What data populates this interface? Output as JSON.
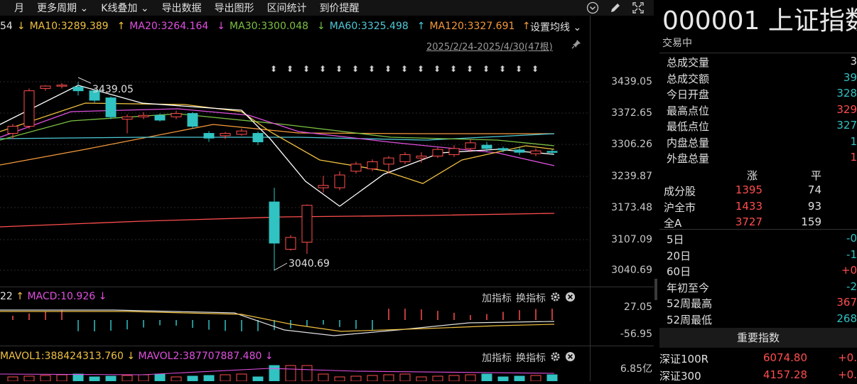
{
  "toolbar": {
    "items": [
      "月",
      "更多周期 ⌄",
      "K线叠加 ⌄",
      "导出数据",
      "导出图形",
      "区间统计",
      "到价提醒"
    ],
    "icons": [
      "chevron-circle-icon",
      "pen-icon",
      "minimize-icon",
      "fullscreen-icon"
    ]
  },
  "ma": {
    "prefix": "54",
    "ma10": "MA10:3289.389",
    "ma10_arrow": "↓",
    "ma20": "MA20:3264.164",
    "ma20_arrow": "↑",
    "ma30": "MA30:3300.048",
    "ma30_arrow": "↓",
    "ma60": "MA60:3325.498",
    "ma60_arrow": "↓",
    "ma120": "MA120:3327.691",
    "ma120_arrow": "↑",
    "settings": "设置均线 ⌄",
    "colors": {
      "ma5": "#ffffff",
      "ma10": "#f0c040",
      "ma20": "#e050e0",
      "ma30": "#7bc043",
      "ma60": "#4ec9d8",
      "ma120": "#f59a3c"
    }
  },
  "range": "2025/2/24-2025/4/30(47根)",
  "axis": {
    "labels": [
      "3439.05",
      "3372.65",
      "3306.26",
      "3239.87",
      "3173.48",
      "3107.09",
      "3040.69"
    ],
    "macd_labels": [
      "27.05",
      "-56.95"
    ],
    "vol_labels": [
      "6.85亿"
    ]
  },
  "annotations": {
    "high": "3439.05",
    "low": "3040.69"
  },
  "macd": {
    "prefix": "22",
    "arrow": "↑",
    "label": "MACD:10.926",
    "label_arrow": "↓",
    "add": "加指标",
    "change": "换指标"
  },
  "vol": {
    "label1": "MAVOL1:388424313.760",
    "arrow1": "↓",
    "label2": "MAVOL2:387707887.480",
    "arrow2": "↓",
    "add": "加指标",
    "change": "换指标"
  },
  "panel": {
    "title": "000001 上证指数",
    "status": "交易中",
    "stats": [
      {
        "k": "总成交量",
        "v": "3",
        "c": "wht"
      },
      {
        "k": "总成交额",
        "v": "39",
        "c": "grn"
      },
      {
        "k": "今日开盘",
        "v": "328",
        "c": "grn"
      },
      {
        "k": "最高点位",
        "v": "329",
        "c": "red"
      },
      {
        "k": "最低点位",
        "v": "327",
        "c": "grn"
      },
      {
        "k": "内盘总量",
        "v": "1",
        "c": "grn"
      },
      {
        "k": "外盘总量",
        "v": "1",
        "c": "red"
      }
    ],
    "breadth_head": {
      "up": "涨",
      "flat": "平"
    },
    "breadth": [
      {
        "k": "成分股",
        "up": "1395",
        "flat": "74"
      },
      {
        "k": "沪全市",
        "up": "1433",
        "flat": "93"
      },
      {
        "k": "全A",
        "up": "3727",
        "flat": "159"
      }
    ],
    "periods": [
      {
        "k": "5日",
        "v": "-0",
        "c": "grn"
      },
      {
        "k": "20日",
        "v": "-1",
        "c": "grn"
      },
      {
        "k": "60日",
        "v": "+0",
        "c": "red"
      },
      {
        "k": "年初至今",
        "v": "-2",
        "c": "grn"
      },
      {
        "k": "52周最高",
        "v": "367",
        "c": "red"
      },
      {
        "k": "52周最低",
        "v": "268",
        "c": "grn"
      }
    ],
    "index_head": "重要指数",
    "indices": [
      {
        "k": "深证100R",
        "v": "6074.80",
        "chg": "+0."
      },
      {
        "k": "深证300",
        "v": "4157.28",
        "chg": "+0."
      }
    ]
  },
  "chart_data": {
    "type": "candlestick",
    "ylim": [
      3020,
      3460
    ],
    "candles": [
      [
        3330,
        3345,
        3318,
        3350
      ],
      [
        3345,
        3420,
        3340,
        3425
      ],
      [
        3425,
        3430,
        3420,
        3432
      ],
      [
        3430,
        3432,
        3425,
        3436
      ],
      [
        3428,
        3420,
        3410,
        3439
      ],
      [
        3420,
        3400,
        3395,
        3422
      ],
      [
        3405,
        3365,
        3360,
        3408
      ],
      [
        3360,
        3365,
        3330,
        3370
      ],
      [
        3365,
        3368,
        3360,
        3375
      ],
      [
        3368,
        3358,
        3355,
        3372
      ],
      [
        3365,
        3372,
        3360,
        3378
      ],
      [
        3372,
        3345,
        3340,
        3375
      ],
      [
        3330,
        3320,
        3312,
        3335
      ],
      [
        3325,
        3330,
        3318,
        3333
      ],
      [
        3328,
        3335,
        3325,
        3340
      ],
      [
        3330,
        3312,
        3305,
        3334
      ],
      [
        3185,
        3098,
        3040,
        3215
      ],
      [
        3085,
        3110,
        3082,
        3115
      ],
      [
        3100,
        3178,
        3075,
        3180
      ],
      [
        3215,
        3220,
        3205,
        3240
      ],
      [
        3215,
        3242,
        3210,
        3250
      ],
      [
        3250,
        3265,
        3245,
        3270
      ],
      [
        3255,
        3270,
        3250,
        3275
      ],
      [
        3265,
        3278,
        3245,
        3282
      ],
      [
        3270,
        3285,
        3265,
        3290
      ],
      [
        3278,
        3282,
        3268,
        3290
      ],
      [
        3282,
        3296,
        3278,
        3300
      ],
      [
        3285,
        3298,
        3280,
        3305
      ],
      [
        3298,
        3310,
        3290,
        3318
      ],
      [
        3305,
        3298,
        3292,
        3312
      ],
      [
        3298,
        3295,
        3290,
        3302
      ],
      [
        3295,
        3290,
        3284,
        3300
      ],
      [
        3287,
        3293,
        3282,
        3298
      ],
      [
        3292,
        3290,
        3284,
        3296
      ]
    ]
  }
}
